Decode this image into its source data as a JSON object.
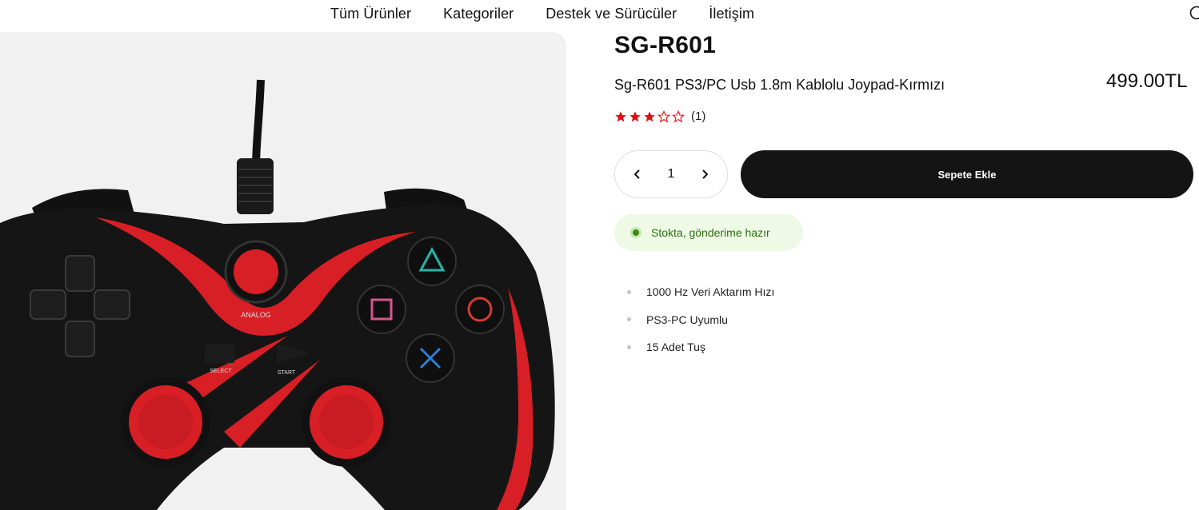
{
  "nav": {
    "items": [
      {
        "label": "Tüm Ürünler"
      },
      {
        "label": "Kategoriler"
      },
      {
        "label": "Destek ve Sürücüler"
      },
      {
        "label": "İletişim"
      }
    ],
    "search_icon": "search-icon"
  },
  "product": {
    "title": "SG-R601",
    "subtitle": "Sg-R601 PS3/PC Usb 1.8m Kablolu Joypad-Kırmızı",
    "price": "499.00TL",
    "rating": 3,
    "rating_max": 5,
    "rating_count": "(1)",
    "quantity": "1",
    "add_to_cart_label": "Sepete Ekle",
    "stock_status": "Stokta, gönderime hazır",
    "features": [
      "1000 Hz Veri Aktarım Hızı",
      "PS3-PC Uyumlu",
      "15 Adet Tuş"
    ],
    "image_labels": {
      "analog": "ANALOG",
      "select": "SELECT",
      "start": "START"
    }
  },
  "colors": {
    "star": "#e50914",
    "button_bg": "#141414",
    "stock_bg": "#eef9e6",
    "stock_dot": "#3d8a15",
    "stock_text": "#2f6f10",
    "gamepad_red": "#d81f26",
    "gamepad_black": "#151515"
  }
}
